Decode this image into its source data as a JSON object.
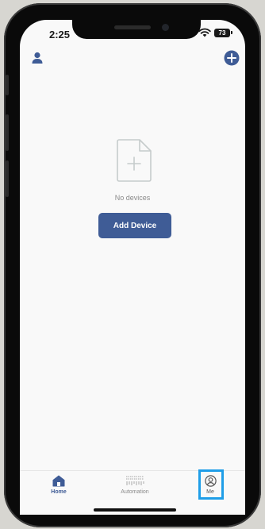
{
  "status_bar": {
    "time": "2:25",
    "battery": "73",
    "icons": [
      "wifi-icon",
      "battery-icon"
    ]
  },
  "header": {
    "left_icon": "user-icon",
    "right_icon": "add-circle-icon"
  },
  "empty_state": {
    "icon": "add-file-icon",
    "message": "No devices",
    "button_label": "Add Device"
  },
  "tab_bar": {
    "tabs": [
      {
        "label": "Home",
        "icon": "home-icon",
        "active": true
      },
      {
        "label": "Automation",
        "icon": "automation-icon",
        "active": false
      },
      {
        "label": "Me",
        "icon": "profile-icon",
        "active": false
      }
    ]
  },
  "colors": {
    "accent": "#3f5c96",
    "highlight": "#1f9ee8",
    "background": "#f9f9f9"
  }
}
